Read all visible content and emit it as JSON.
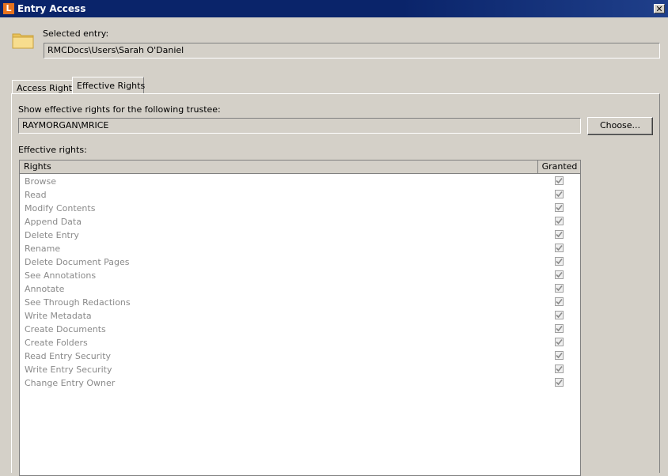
{
  "window": {
    "title": "Entry Access",
    "app_letter": "L",
    "close_glyph": "✕"
  },
  "selected_entry": {
    "label": "Selected entry:",
    "value": "RMCDocs\\Users\\Sarah O'Daniel"
  },
  "tabs": [
    {
      "label": "Access Rights",
      "active": false
    },
    {
      "label": "Effective Rights",
      "active": true
    }
  ],
  "trustee": {
    "label": "Show effective rights for the following trustee:",
    "value": "RAYMORGAN\\MRICE",
    "choose_label": "Choose..."
  },
  "effective_rights": {
    "label": "Effective rights:",
    "columns": [
      "Rights",
      "Granted"
    ],
    "rows": [
      {
        "name": "Browse",
        "granted": true
      },
      {
        "name": "Read",
        "granted": true
      },
      {
        "name": "Modify Contents",
        "granted": true
      },
      {
        "name": "Append Data",
        "granted": true
      },
      {
        "name": "Delete Entry",
        "granted": true
      },
      {
        "name": "Rename",
        "granted": true
      },
      {
        "name": "Delete Document Pages",
        "granted": true
      },
      {
        "name": "See Annotations",
        "granted": true
      },
      {
        "name": "Annotate",
        "granted": true
      },
      {
        "name": "See Through Redactions",
        "granted": true
      },
      {
        "name": "Write Metadata",
        "granted": true
      },
      {
        "name": "Create Documents",
        "granted": true
      },
      {
        "name": "Create Folders",
        "granted": true
      },
      {
        "name": "Read Entry Security",
        "granted": true
      },
      {
        "name": "Write Entry Security",
        "granted": true
      },
      {
        "name": "Change Entry Owner",
        "granted": true
      }
    ]
  },
  "icons": {
    "app": "laserfiche-icon",
    "folder": "folder-icon",
    "close": "close-icon",
    "check": "checkmark-icon"
  },
  "colors": {
    "titlebar": "#0a246a",
    "app_icon": "#e8731e",
    "folder": "#f3d27a",
    "disabled_text": "#8a8a8a"
  }
}
